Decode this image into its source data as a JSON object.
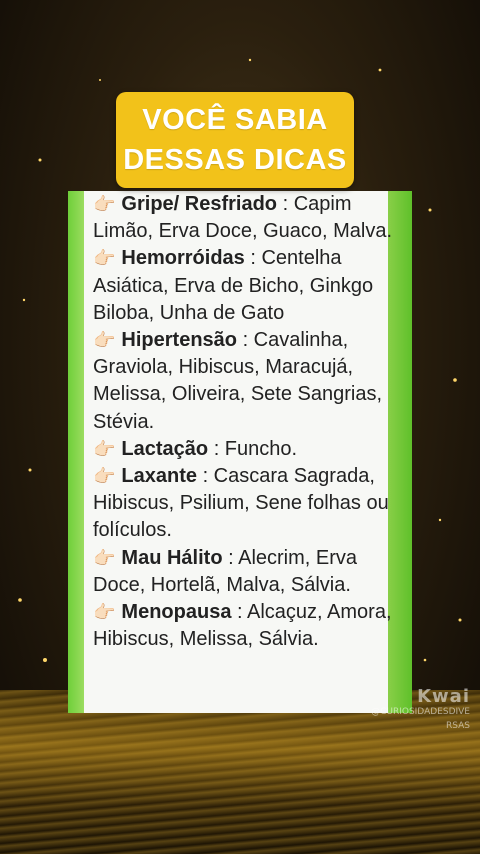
{
  "title": {
    "line1": "VOCÊ SABIA",
    "line2": "DESSAS DICAS"
  },
  "entries": [
    {
      "condition": "Gripe/ Resfriado",
      "herbs": " : Capim Limão, Erva Doce, Guaco, Malva."
    },
    {
      "condition": "Hemorróidas",
      "herbs": " : Centelha Asiática, Erva de Bicho, Ginkgo Biloba, Unha de Gato"
    },
    {
      "condition": "Hipertensão",
      "herbs": " : Cavalinha, Graviola, Hibiscus, Maracujá, Melissa, Oliveira, Sete Sangrias, Stévia."
    },
    {
      "condition": "Lactação",
      "herbs": " : Funcho."
    },
    {
      "condition": "Laxante",
      "herbs": " : Cascara Sagrada, Hibiscus, Psilium, Sene folhas ou folículos."
    },
    {
      "condition": "Mau Hálito",
      "herbs": " : Alecrim, Erva Doce, Hortelã, Malva, Sálvia."
    },
    {
      "condition": "Menopausa",
      "herbs": " : Alcaçuz, Amora, Hibiscus, Melissa, Sálvia."
    }
  ],
  "watermark": {
    "logo": "Kwai",
    "handle": "@CURIOSIDADESDIVE",
    "code": "RSAS"
  },
  "colors": {
    "badge": "#f2c21a",
    "card_border": "#8fd14c"
  },
  "icons": {
    "bullet": "pointing-hand-icon"
  }
}
